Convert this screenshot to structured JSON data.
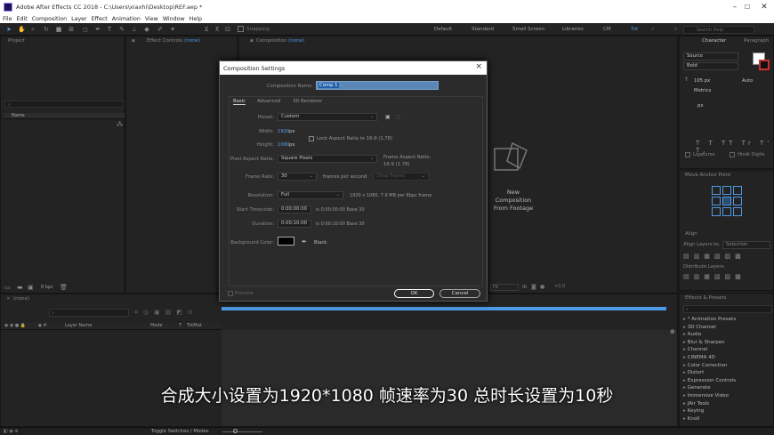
{
  "window": {
    "title": "Adobe After Effects CC 2018 - C:\\Users\\xiaxhi\\Desktop\\REF.aep *",
    "controls": [
      "–",
      "☐",
      "✕"
    ]
  },
  "menu": [
    "File",
    "Edit",
    "Composition",
    "Layer",
    "Effect",
    "Animation",
    "View",
    "Window",
    "Help"
  ],
  "toolbar": {
    "snapping_label": "Snapping",
    "workspaces": [
      "Default",
      "Standard",
      "Small Screen",
      "Libraries",
      "CM",
      "Tut"
    ],
    "active_workspace": "Tut",
    "search_help_placeholder": "Search Help"
  },
  "panels": {
    "project": {
      "title": "Project",
      "search_placeholder": "",
      "column_name": "Name",
      "bpc": "8 bpc"
    },
    "effect_controls": {
      "title": "Effect Controls",
      "value": "(none)"
    },
    "composition": {
      "title": "Composition",
      "value": "(none)",
      "new_comp_label": [
        "New",
        "Composition",
        "From Footage"
      ]
    },
    "character": {
      "title": "Character",
      "tab2": "Paragraph",
      "font": "Source",
      "style": "Bold",
      "size": "105 px",
      "leading": "Auto",
      "tracking": "Metrics",
      "indent": "px",
      "ligatures": "Ligatures",
      "hindi_digits": "Hindi Digits"
    },
    "align_anchor": {
      "title": "Move Anchor Point",
      "align_title": "Align",
      "align_layers_to": "Align Layers to:",
      "selection": "Selection",
      "distribute_layers": "Distribute Layers:"
    },
    "effects": {
      "title": "Effects & Presets",
      "items": [
        "* Animation Presets",
        "3D Channel",
        "Audio",
        "Blur & Sharpen",
        "Channel",
        "CINEMA 4D",
        "Color Correction",
        "Distort",
        "Expression Controls",
        "Generate",
        "Immersive Video",
        "JAir Tools",
        "Keying",
        "Knoll"
      ]
    },
    "timeline": {
      "title": "(none)",
      "columns": [
        "Layer Name",
        "Mode",
        "T",
        "TrkMat"
      ],
      "toggle_label": "Toggle Switches / Modes"
    }
  },
  "dialog": {
    "title": "Composition Settings",
    "comp_name_label": "Composition Name:",
    "comp_name_value": "Comp 1",
    "tabs": [
      "Basic",
      "Advanced",
      "3D Renderer"
    ],
    "active_tab": "Basic",
    "preset_label": "Preset:",
    "preset_value": "Custom",
    "width_label": "Width:",
    "width_value": "1920",
    "width_unit": "px",
    "lock_label": "Lock Aspect Ratio to 16:9 (1.78)",
    "height_label": "Height:",
    "height_value": "1080",
    "height_unit": "px",
    "par_label": "Pixel Aspect Ratio:",
    "par_value": "Square Pixels",
    "frame_aspect_label": "Frame Aspect Ratio:",
    "frame_aspect_value": "16:9 (1.78)",
    "frame_rate_label": "Frame Rate:",
    "frame_rate_value": "30",
    "fps_label": "frames per second",
    "drop_frame": "Drop Frame",
    "resolution_label": "Resolution:",
    "resolution_value": "Full",
    "resolution_info": "1920 x 1080, 7.9 MB per 8bpc frame",
    "start_tc_label": "Start Timecode:",
    "start_tc_value": "0:00:00:00",
    "start_tc_info": "is 0:00:00:00  Base 30",
    "duration_label": "Duration:",
    "duration_value": "0:00:10:00",
    "duration_info": "is 0:00:10:00  Base 30",
    "bg_color_label": "Background Color:",
    "bg_color_name": "Black",
    "preview_label": "Preview",
    "ok_label": "OK",
    "cancel_label": "Cancel"
  },
  "subtitle": "合成大小设置为1920*1080 帧速率为30 总时长设置为10秒",
  "colors": {
    "accent": "#4e9ae6",
    "bg": "#1d1d1d",
    "panel": "#232323",
    "dialog": "#2b2b2b"
  }
}
